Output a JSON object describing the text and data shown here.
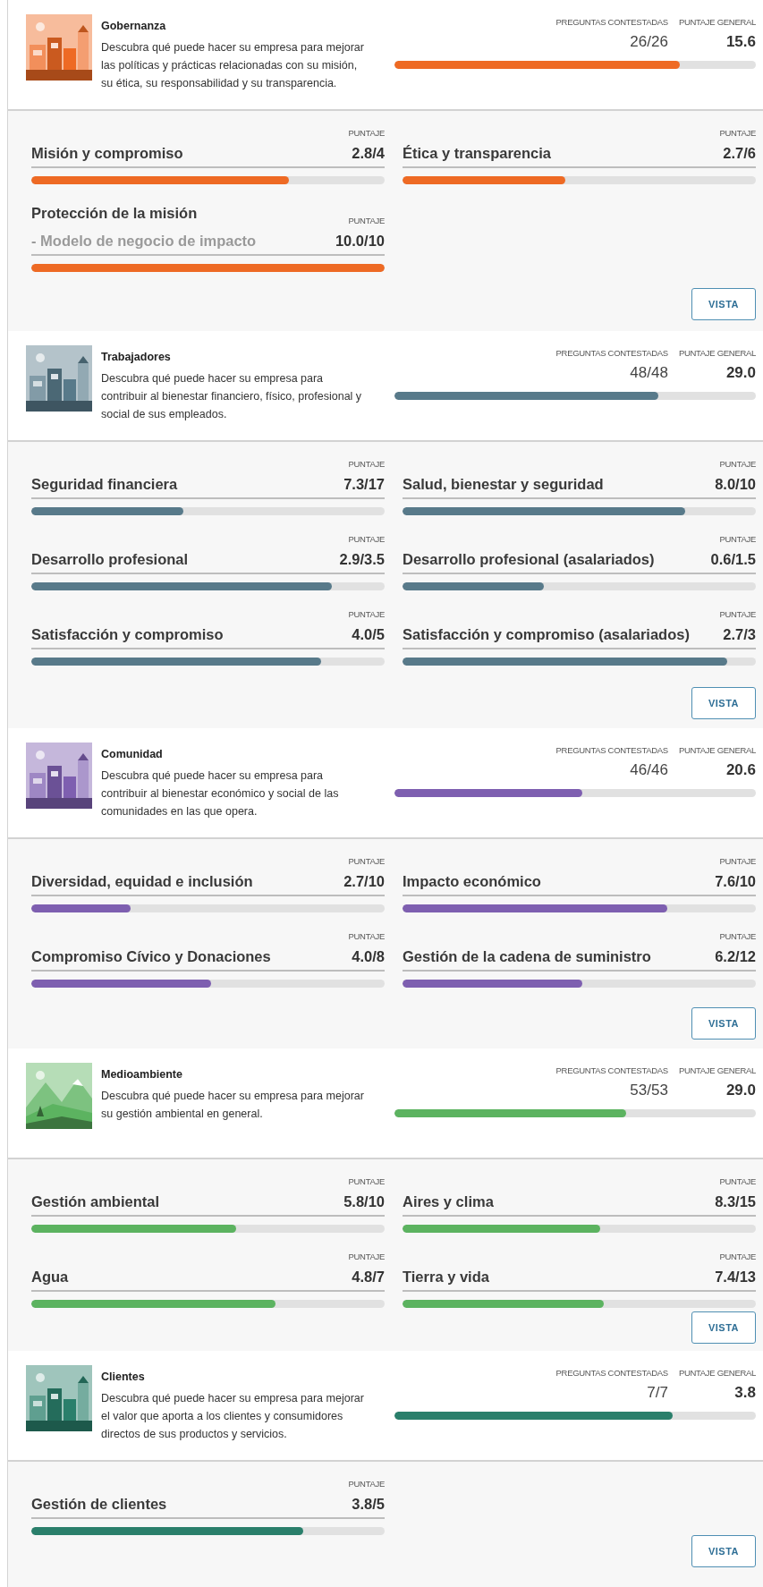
{
  "sections": [
    {
      "title": "Gobernanza",
      "description": "Descubra qué puede hacer su empresa para mejorar las políticas y prácticas relacionadas con su misión, su ética, su responsabilidad y su transparencia.",
      "color": "#ee6a24",
      "answered_label": "PREGUNTAS CONTESTADAS",
      "answered": "26/26",
      "overall_label": "PUNTAJE GENERAL",
      "overall": "15.6",
      "level": 0.79,
      "items": [
        {
          "title": "Misión y compromiso",
          "score_label": "PUNTAJE",
          "score": "2.8/4",
          "level": 0.73
        },
        {
          "title": "Ética y transparencia",
          "score_label": "PUNTAJE",
          "score": "2.7/6",
          "level": 0.46
        },
        {
          "title": "Protección de la misión",
          "subtitle": "- Modelo de negocio de impacto",
          "score_label": "PUNTAJE",
          "score": "10.0/10",
          "level": 1.0
        }
      ],
      "button": "VISTA"
    },
    {
      "title": "Trabajadores",
      "description": "Descubra qué puede hacer su empresa para contribuir al bienestar financiero, físico, profesional y social de sus empleados.",
      "color": "#587a8a",
      "answered_label": "PREGUNTAS CONTESTADAS",
      "answered": "48/48",
      "overall_label": "PUNTAJE GENERAL",
      "overall": "29.0",
      "level": 0.73,
      "items": [
        {
          "title": "Seguridad financiera",
          "score_label": "PUNTAJE",
          "score": "7.3/17",
          "level": 0.43
        },
        {
          "title": "Salud, bienestar y seguridad",
          "score_label": "PUNTAJE",
          "score": "8.0/10",
          "level": 0.8
        },
        {
          "title": "Desarrollo profesional",
          "score_label": "PUNTAJE",
          "score": "2.9/3.5",
          "level": 0.85
        },
        {
          "title": "Desarrollo profesional (asalariados)",
          "score_label": "PUNTAJE",
          "score": "0.6/1.5",
          "level": 0.4
        },
        {
          "title": "Satisfacción y compromiso",
          "score_label": "PUNTAJE",
          "score": "4.0/5",
          "level": 0.82
        },
        {
          "title": "Satisfacción y compromiso (asalariados)",
          "score_label": "PUNTAJE",
          "score": "2.7/3",
          "level": 0.92
        }
      ],
      "button": "VISTA"
    },
    {
      "title": "Comunidad",
      "description": "Descubra qué puede hacer su empresa para contribuir al bienestar económico y social de las comunidades en las que opera.",
      "color": "#7e5fb0",
      "answered_label": "PREGUNTAS CONTESTADAS",
      "answered": "46/46",
      "overall_label": "PUNTAJE GENERAL",
      "overall": "20.6",
      "level": 0.52,
      "items": [
        {
          "title": "Diversidad, equidad e inclusión",
          "score_label": "PUNTAJE",
          "score": "2.7/10",
          "level": 0.28
        },
        {
          "title": "Impacto económico",
          "score_label": "PUNTAJE",
          "score": "7.6/10",
          "level": 0.75
        },
        {
          "title": "Compromiso Cívico y Donaciones",
          "score_label": "PUNTAJE",
          "score": "4.0/8",
          "level": 0.51
        },
        {
          "title": "Gestión de la cadena de suministro",
          "score_label": "PUNTAJE",
          "score": "6.2/12",
          "level": 0.51
        }
      ],
      "button": "VISTA"
    },
    {
      "title": "Medioambiente",
      "description": "Descubra qué puede hacer su empresa para mejorar su gestión ambiental en general.",
      "color": "#5cb360",
      "answered_label": "PREGUNTAS CONTESTADAS",
      "answered": "53/53",
      "overall_label": "PUNTAJE GENERAL",
      "overall": "29.0",
      "level": 0.64,
      "items": [
        {
          "title": "Gestión ambiental",
          "score_label": "PUNTAJE",
          "score": "5.8/10",
          "level": 0.58
        },
        {
          "title": "Aires y clima",
          "score_label": "PUNTAJE",
          "score": "8.3/15",
          "level": 0.56
        },
        {
          "title": "Agua",
          "score_label": "PUNTAJE",
          "score": "4.8/7",
          "level": 0.69
        },
        {
          "title": "Tierra y vida",
          "score_label": "PUNTAJE",
          "score": "7.4/13",
          "level": 0.57
        }
      ],
      "button": "VISTA"
    },
    {
      "title": "Clientes",
      "description": "Descubra qué puede hacer su empresa para mejorar el valor que aporta a los clientes y consumidores directos de sus productos y servicios.",
      "color": "#2a7f6b",
      "answered_label": "PREGUNTAS CONTESTADAS",
      "answered": "7/7",
      "overall_label": "PUNTAJE GENERAL",
      "overall": "3.8",
      "level": 0.77,
      "items": [
        {
          "title": "Gestión de clientes",
          "score_label": "PUNTAJE",
          "score": "3.8/5",
          "level": 0.77
        }
      ],
      "button": "VISTA"
    }
  ]
}
